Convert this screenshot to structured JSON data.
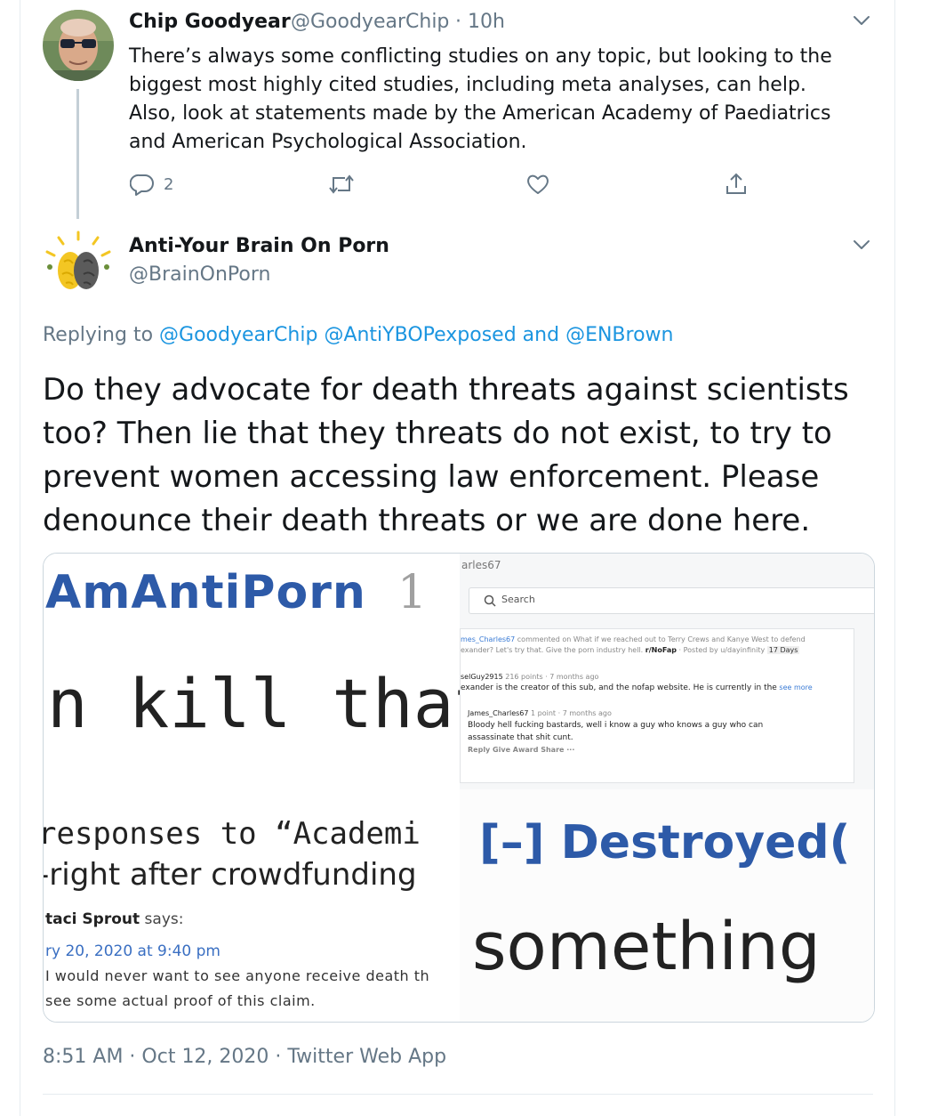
{
  "tweet1": {
    "name": "Chip Goodyear",
    "handle": "@GoodyearChip",
    "time": "· 10h",
    "text": "There’s always some conflicting studies on any topic, but looking to the biggest most highly cited studies, including meta analyses, can help. Also, look at statements made by the American Academy of Paediatrics and American Psychological Association.",
    "reply_count": "2"
  },
  "tweet2": {
    "name": "Anti-Your Brain On Porn",
    "handle": "@BrainOnPorn",
    "replying_prefix": "Replying to",
    "mention1": "@GoodyearChip",
    "mention2": "@AntiYBOPexposed",
    "and_word": "and",
    "mention3": "@ENBrown",
    "text": "Do they advocate for death threats against scientists too? Then lie that they threats do not exist, to try to prevent women accessing law enforcement. Please denounce their death threats or we are done here.",
    "timestamp": "8:51 AM · Oct 12, 2020 · Twitter Web App"
  },
  "media": {
    "q1": {
      "title": "AmAntiPorn",
      "title_num": "1",
      "line": "n kill that b"
    },
    "q2": {
      "header": "arles67",
      "search": "Search",
      "item1_user": "mes_Charles67",
      "item1_mid": "commented on",
      "item1_rest": "What if we reached out to Terry Crews and Kanye West to defend",
      "item1_line2": "exander? Let's try that. Give the porn industry hell.",
      "item1_sub": "r/NoFap",
      "item1_posted": "· Posted by u/dayinfinity",
      "item1_badge": "17 Days",
      "item2_user": "selGuy2915",
      "item2_meta": "216 points · 7 months ago",
      "item2_text": "exander is the creator of this sub, and the nofap website. He is currently in the",
      "item2_more": "see more",
      "item3_user": "James_Charles67",
      "item3_meta": "1 point · 7 months ago",
      "item3_text1": "Bloody hell fucking bastards, well i know a guy who knows a guy who can",
      "item3_text2": "assassinate that shit cunt.",
      "item3_actions": "Reply   Give Award   Share   ···"
    },
    "q3": {
      "line1": "responses to “Academi",
      "line2": "-right after crowdfunding",
      "author": "taci Sprout",
      "says": "says:",
      "date": "ry 20, 2020 at 9:40 pm",
      "body1": "I would never want to see anyone receive death th",
      "body2": "see some actual proof of this claim."
    },
    "q4": {
      "title": "[–] Destroyed(",
      "line": "something"
    }
  },
  "colors": {
    "link": "#1b95e0",
    "muted": "#657786",
    "text": "#14171a",
    "border": "#e6ecf0",
    "q1_title": "#2d5aa8"
  }
}
